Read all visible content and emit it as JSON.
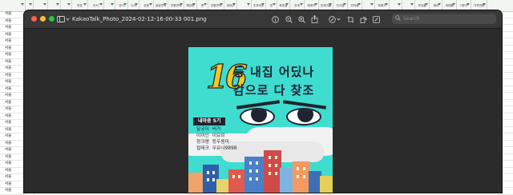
{
  "spreadsheet": {
    "columns": [
      "",
      "",
      "",
      "",
      "",
      "번호",
      "단지",
      "",
      "연식",
      "나이",
      "유형",
      "공급면적",
      "전용면적",
      "해당층",
      "층",
      "전용면적",
      "세대수",
      "",
      "주차대수",
      "방",
      "화장실",
      "전세",
      "매매가",
      "전세가율",
      "전고점",
      "전저점",
      "",
      "매매가",
      "",
      "",
      "보유율",
      "세대",
      "세대율",
      "기준가",
      "가격변동"
    ],
    "row_label": "서울",
    "row_count": 27,
    "header_accent": "#3a8a3a"
  },
  "window": {
    "title": "KakaoTalk_Photo_2024-02-12-16-00-33 001.png",
    "search_placeholder": "Search",
    "toolbar_icons": [
      "sidebar-icon",
      "chevron-down-icon",
      "info-icon",
      "zoom-out-icon",
      "zoom-in-icon",
      "share-icon",
      "markup-pen-icon",
      "markup-chevron-icon",
      "crop-icon",
      "rotate-icon",
      "annotate-icon",
      "search-icon"
    ]
  },
  "poster": {
    "number": "16",
    "headline_line1": "등 내집 어딨나",
    "headline_line2": "감으로 다 찾조",
    "badge": "내마중 5기",
    "staff": [
      {
        "role": "달궁이",
        "name": "버거"
      },
      {
        "role": "이이인",
        "name": "이요브"
      },
      {
        "role": "청크량",
        "name": "등두용미"
      },
      {
        "role": "컬태크",
        "name": "우유나9898"
      }
    ],
    "colors": {
      "background": "#3fdcd0",
      "number": "#f4c91d",
      "ink": "#1f2430"
    }
  }
}
